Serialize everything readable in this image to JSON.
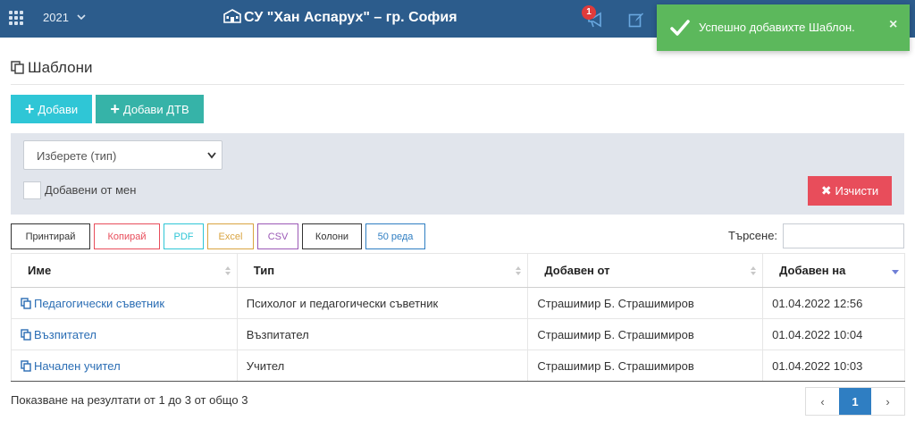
{
  "topbar": {
    "year": "2021",
    "school_title": "СУ \"Хан Аспарух\" – гр. София",
    "notification_count": "1"
  },
  "toast": {
    "message": "Успешно добавихте Шаблон.",
    "close": "×",
    "color": "#5cb85c"
  },
  "page": {
    "title": "Шаблони",
    "add_button": "Добави",
    "add_dtv_button": "Добави ДТВ"
  },
  "filters": {
    "type_select_value": "Изберете (тип)",
    "mine_label": "Добавени от мен",
    "clear_button": "Изчисти"
  },
  "export_buttons": [
    {
      "label": "Принтирай",
      "color": "#333333"
    },
    {
      "label": "Копирай",
      "color": "#e84d5b"
    },
    {
      "label": "PDF",
      "color": "#2fc6d6"
    },
    {
      "label": "Excel",
      "color": "#d9a441"
    },
    {
      "label": "CSV",
      "color": "#9b59b6"
    },
    {
      "label": "Колони",
      "color": "#333333"
    },
    {
      "label": "50 реда",
      "color": "#2f7ec2"
    }
  ],
  "search": {
    "label": "Търсене:",
    "value": ""
  },
  "table": {
    "columns": [
      "Име",
      "Тип",
      "Добавен от",
      "Добавен на"
    ],
    "rows": [
      {
        "name": "Педагогически съветник",
        "type": "Психолог и педагогически съветник",
        "added_by": "Страшимир Б. Страшимиров",
        "added_on": "01.04.2022 12:56"
      },
      {
        "name": "Възпитател",
        "type": "Възпитател",
        "added_by": "Страшимир Б. Страшимиров",
        "added_on": "01.04.2022 10:04"
      },
      {
        "name": "Начален учител",
        "type": "Учител",
        "added_by": "Страшимир Б. Страшимиров",
        "added_on": "01.04.2022 10:03"
      }
    ]
  },
  "footer": {
    "info": "Показване на резултати от 1 до 3 от общо 3",
    "prev": "‹",
    "current_page": "1",
    "next": "›"
  },
  "icons": [
    "apps-grid-icon",
    "chevron-down-icon",
    "school-icon",
    "megaphone-icon",
    "edit-icon",
    "check-icon",
    "close-icon",
    "copy-icon",
    "plus-icon",
    "times-icon",
    "sort-icon"
  ]
}
